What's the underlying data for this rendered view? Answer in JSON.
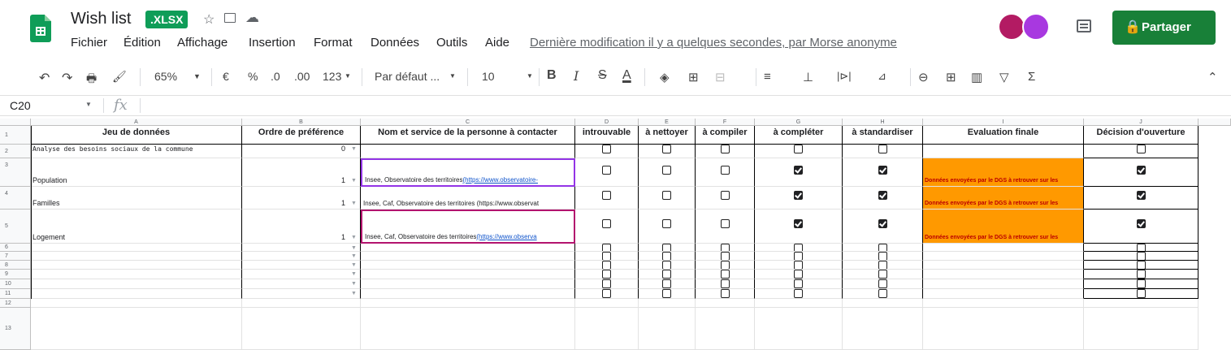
{
  "doc": {
    "title": "Wish list",
    "badge": ".XLSX"
  },
  "menus": [
    "Fichier",
    "Édition",
    "Affichage",
    "Insertion",
    "Format",
    "Données",
    "Outils",
    "Aide"
  ],
  "last_modified": "Dernière modification il y a quelques secondes, par Morse anonyme",
  "share_label": "Partager",
  "toolbar": {
    "zoom": "65%",
    "currency": "€",
    "percent": "%",
    "dec_less": ".0",
    "dec_more": ".00",
    "num_format": "123",
    "font": "Par défaut ...",
    "font_size": "10",
    "bold": "B",
    "italic": "I",
    "strike": "S",
    "text_color": "A"
  },
  "formula_bar": {
    "cell_ref": "C20",
    "fx": "fx"
  },
  "columns": [
    "A",
    "B",
    "C",
    "D",
    "E",
    "F",
    "G",
    "H",
    "I",
    "J"
  ],
  "row_numbers": [
    "1",
    "2",
    "3",
    "4",
    "5",
    "6",
    "7",
    "8",
    "9",
    "10",
    "11",
    "12",
    "13"
  ],
  "headers": [
    "Jeu de données",
    "Ordre de préférence",
    "Nom et service de la personne à contacter",
    "introuvable",
    "à nettoyer",
    "à compiler",
    "à compléter",
    "à standardiser",
    "Evaluation finale",
    "Décision d'ouverture"
  ],
  "rows": [
    {
      "a": "Analyse des besoins sociaux de la commune",
      "b": "0",
      "c_pre": "",
      "c_link": "",
      "checks": [
        false,
        false,
        false,
        false,
        false
      ],
      "eval": "",
      "decision": false
    },
    {
      "a": "Population",
      "b": "1",
      "c_pre": "Insee, Observatoire des territoires ",
      "c_link": "(https://www.observatoire-",
      "checks": [
        false,
        false,
        false,
        true,
        true
      ],
      "eval": "Données envoyées par le DGS à retrouver sur les",
      "decision": true
    },
    {
      "a": "Familles",
      "b": "1",
      "c_pre": "Insee, Caf, Observatoire des territoires (https://www.observat",
      "c_link": "",
      "checks": [
        false,
        false,
        false,
        true,
        true
      ],
      "eval": "Données envoyées par le DGS à retrouver sur les",
      "decision": true
    },
    {
      "a": "Logement",
      "b": "1",
      "c_pre": "Insee, Caf, Observatoire des territoires ",
      "c_link": "(https://www.observa",
      "checks": [
        false,
        false,
        false,
        true,
        true
      ],
      "eval": "Données envoyées par le DGS à retrouver sur les",
      "decision": true
    },
    {
      "a": "",
      "b": "",
      "c_pre": "",
      "c_link": "",
      "checks": [
        false,
        false,
        false,
        false,
        false
      ],
      "eval": "",
      "decision": false
    },
    {
      "a": "",
      "b": "",
      "c_pre": "",
      "c_link": "",
      "checks": [
        false,
        false,
        false,
        false,
        false
      ],
      "eval": "",
      "decision": false
    },
    {
      "a": "",
      "b": "",
      "c_pre": "",
      "c_link": "",
      "checks": [
        false,
        false,
        false,
        false,
        false
      ],
      "eval": "",
      "decision": false
    },
    {
      "a": "",
      "b": "",
      "c_pre": "",
      "c_link": "",
      "checks": [
        false,
        false,
        false,
        false,
        false
      ],
      "eval": "",
      "decision": false
    },
    {
      "a": "",
      "b": "",
      "c_pre": "",
      "c_link": "",
      "checks": [
        false,
        false,
        false,
        false,
        false
      ],
      "eval": "",
      "decision": false
    },
    {
      "a": "",
      "b": "",
      "c_pre": "",
      "c_link": "",
      "checks": [
        false,
        false,
        false,
        false,
        false
      ],
      "eval": "",
      "decision": false
    }
  ],
  "colors": {
    "brand_green": "#0f9d58",
    "share_green": "#188038",
    "orange": "#ff9900"
  }
}
